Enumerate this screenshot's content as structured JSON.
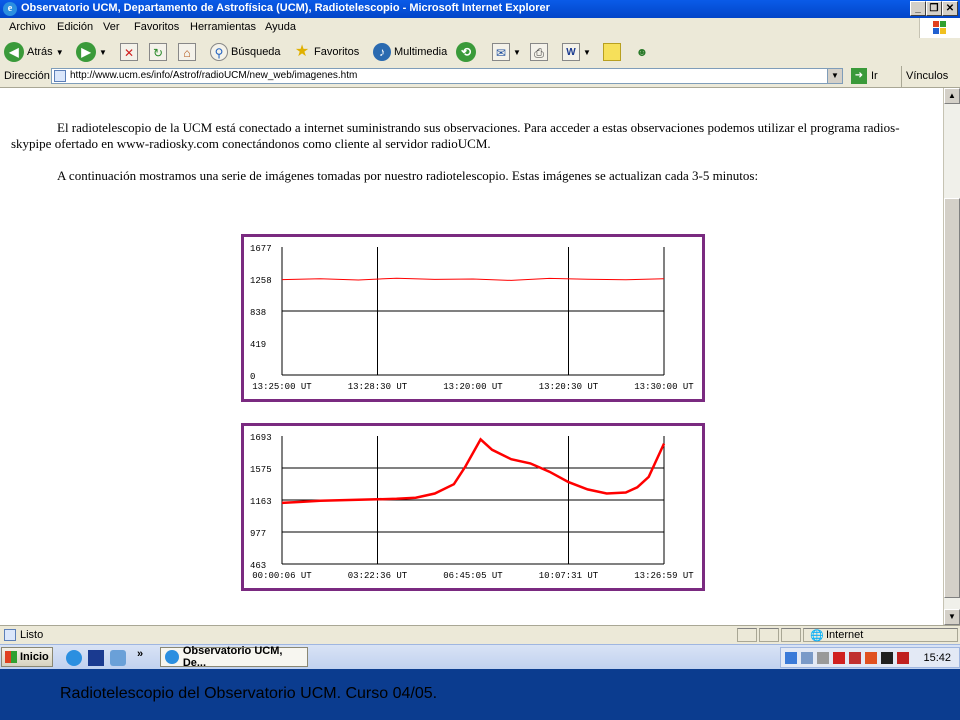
{
  "window": {
    "title": "Observatorio UCM, Departamento de Astrofísica (UCM), Radiotelescopio - Microsoft Internet Explorer",
    "minimize": "_",
    "restore": "❐",
    "close": "✕"
  },
  "menubar": {
    "items": [
      "Archivo",
      "Edición",
      "Ver",
      "Favoritos",
      "Herramientas",
      "Ayuda"
    ]
  },
  "toolbar": {
    "back_label": "Atrás",
    "search_label": "Búsqueda",
    "favorites_label": "Favoritos",
    "media_label": "Multimedia"
  },
  "addressbar": {
    "label": "Dirección",
    "url": "http://www.ucm.es/info/Astrof/radioUCM/new_web/imagenes.htm",
    "go_label": "Ir",
    "links_label": "Vínculos"
  },
  "content": {
    "paragraph1": "El radiotelescopio de la UCM está conectado a internet suministrando sus observaciones. Para acceder a estas observaciones podemos utilizar el programa radios-skypipe ofertado en www-radiosky.com conectándonos como cliente al servidor radioUCM.",
    "paragraph2": "A continuación mostramos una serie de imágenes tomadas por nuestro radiotelescopio. Estas imágenes se actualizan cada 3-5 minutos:"
  },
  "chart_data": [
    {
      "type": "line",
      "y_ticks": [
        "1677",
        "1258",
        "838",
        "419",
        "0"
      ],
      "x_ticks": [
        "13:25:00 UT",
        "13:28:30 UT",
        "13:20:00 UT",
        "13:20:30 UT",
        "13:30:00 UT"
      ],
      "ylim": [
        0,
        1677
      ],
      "series": [
        {
          "color": "#ff0000",
          "x": [
            0,
            0.1,
            0.2,
            0.3,
            0.4,
            0.5,
            0.6,
            0.7,
            0.8,
            0.9,
            1.0
          ],
          "values": [
            1250,
            1262,
            1245,
            1268,
            1252,
            1258,
            1240,
            1265,
            1255,
            1248,
            1260
          ]
        }
      ]
    },
    {
      "type": "line",
      "y_ticks": [
        "1693",
        "1575",
        "1163",
        "977",
        "463"
      ],
      "x_ticks": [
        "00:00:06 UT",
        "03:22:36 UT",
        "06:45:05 UT",
        "10:07:31 UT",
        "13:26:59 UT"
      ],
      "ylim": [
        463,
        1693
      ],
      "series": [
        {
          "color": "#ff0000",
          "x": [
            0,
            0.05,
            0.1,
            0.15,
            0.2,
            0.25,
            0.3,
            0.35,
            0.4,
            0.45,
            0.48,
            0.52,
            0.55,
            0.6,
            0.65,
            0.7,
            0.75,
            0.8,
            0.85,
            0.9,
            0.93,
            0.96,
            1.0
          ],
          "values": [
            1050,
            1060,
            1070,
            1075,
            1080,
            1085,
            1090,
            1100,
            1140,
            1230,
            1400,
            1660,
            1560,
            1470,
            1430,
            1350,
            1250,
            1180,
            1140,
            1150,
            1200,
            1300,
            1620
          ]
        }
      ]
    }
  ],
  "statusbar": {
    "status": "Listo",
    "zone": "Internet"
  },
  "taskbar": {
    "start_label": "Inicio",
    "task_label": "Observatorio UCM, De...",
    "clock": "15:42"
  },
  "caption": "Radiotelescopio del Observatorio UCM. Curso 04/05."
}
